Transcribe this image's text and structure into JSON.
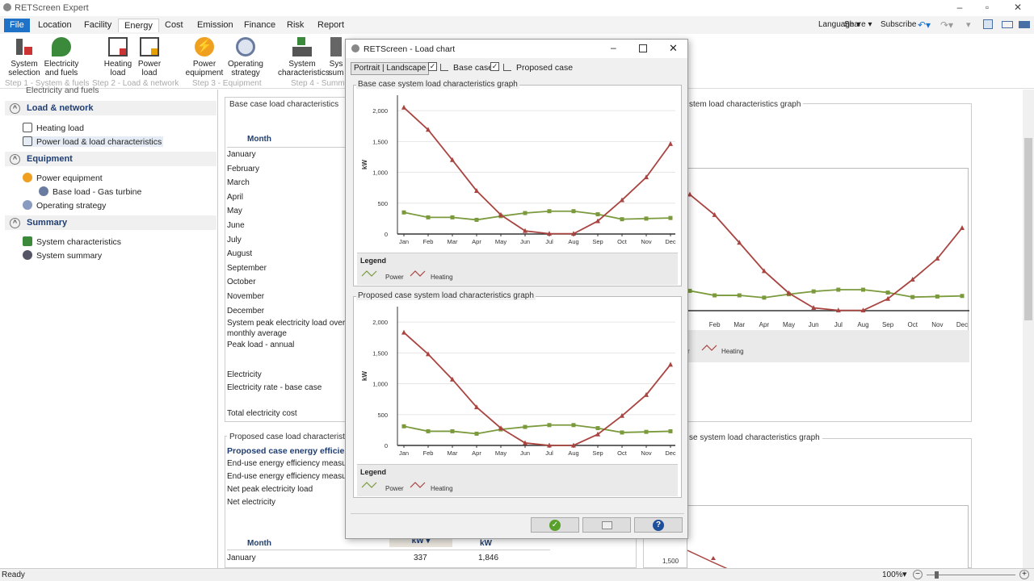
{
  "app": {
    "title": "RETScreen Expert"
  },
  "menu": {
    "items": [
      "File",
      "Location",
      "Facility",
      "Energy",
      "Cost",
      "Emission",
      "Finance",
      "Risk",
      "Report"
    ],
    "right": [
      "Language ▾",
      "Share ▾",
      "Subscribe"
    ]
  },
  "ribbon": {
    "buttons": [
      {
        "l1": "System",
        "l2": "selection"
      },
      {
        "l1": "Electricity",
        "l2": "and fuels"
      },
      {
        "l1": "Heating",
        "l2": "load"
      },
      {
        "l1": "Power",
        "l2": "load"
      },
      {
        "l1": "Power",
        "l2": "equipment"
      },
      {
        "l1": "Operating",
        "l2": "strategy"
      },
      {
        "l1": "System",
        "l2": "characteristics"
      },
      {
        "l1": "Sys",
        "l2": "sum"
      }
    ],
    "steps": [
      "Step 1 - System & fuels",
      "Step 2 - Load & network",
      "Step 3 - Equipment",
      "Step 4 - Summa"
    ]
  },
  "nav": {
    "top_item": "Electricity and fuels",
    "sections": [
      {
        "title": "Load & network",
        "items": [
          "Heating load",
          "Power load & load characteristics"
        ]
      },
      {
        "title": "Equipment",
        "items": [
          "Power equipment",
          "Base load - Gas turbine",
          "Operating strategy"
        ]
      },
      {
        "title": "Summary",
        "items": [
          "System characteristics",
          "System summary"
        ]
      }
    ]
  },
  "main": {
    "base_panel_title": "Base case load characteristics",
    "month_header": "Month",
    "months": [
      "January",
      "February",
      "March",
      "April",
      "May",
      "June",
      "July",
      "August",
      "September",
      "October",
      "November",
      "December"
    ],
    "peak_l1": "System peak electricity load over m",
    "peak_l2": "monthly average",
    "peak_annual": "Peak load - annual",
    "electricity": "Electricity",
    "elec_rate": "Electricity rate - base case",
    "total_cost": "Total electricity cost",
    "right_top_title": "stem load characteristics graph",
    "proposed_panel_title": "Proposed case load characteristics",
    "proposed_bold": "Proposed case energy efficiency",
    "p1": "End-use energy efficiency measure",
    "p2": "End-use energy efficiency measure",
    "p3": "Net peak electricity load",
    "p4": "Net electricity",
    "month2": "Month",
    "unit_dropdown": "kW",
    "unit_kw": "kW",
    "jan_label": "January",
    "jan_v1": "337",
    "jan_v2": "1,846",
    "right_bottom_title": "se system load characteristics graph",
    "bg_legend_heating": "Heating",
    "bg_legend_power_frag": "r",
    "bg_ytick": "1,500"
  },
  "dialog": {
    "title": "RETScreen - Load chart",
    "orientation_btn": "Portrait | Landscape",
    "base_case_label": "Base case",
    "proposed_case_label": "Proposed case",
    "legend_title": "Legend"
  },
  "status": {
    "left": "Ready",
    "zoom": "100%"
  },
  "colors": {
    "power": "#7a9a3c",
    "heating": "#a94440",
    "accent": "#1e73c8"
  },
  "chart_data": [
    {
      "type": "line",
      "title": "Base case system load characteristics graph",
      "ylabel": "kW",
      "categories": [
        "Jan",
        "Feb",
        "Mar",
        "Apr",
        "May",
        "Jun",
        "Jul",
        "Aug",
        "Sep",
        "Oct",
        "Nov",
        "Dec"
      ],
      "ylim": [
        0,
        2250
      ],
      "yticks": [
        "0",
        "500",
        "1,000",
        "1,500",
        "2,000"
      ],
      "series": [
        {
          "name": "Power",
          "values": [
            350,
            270,
            270,
            230,
            290,
            340,
            370,
            370,
            320,
            240,
            250,
            260
          ]
        },
        {
          "name": "Heating",
          "values": [
            2050,
            1690,
            1200,
            700,
            310,
            50,
            5,
            5,
            210,
            550,
            920,
            1460
          ]
        }
      ],
      "legend": "bottom"
    },
    {
      "type": "line",
      "title": "Proposed case system load characteristics graph",
      "ylabel": "kW",
      "categories": [
        "Jan",
        "Feb",
        "Mar",
        "Apr",
        "May",
        "Jun",
        "Jul",
        "Aug",
        "Sep",
        "Oct",
        "Nov",
        "Dec"
      ],
      "ylim": [
        0,
        2250
      ],
      "yticks": [
        "0",
        "500",
        "1,000",
        "1,500",
        "2,000"
      ],
      "series": [
        {
          "name": "Power",
          "values": [
            310,
            230,
            230,
            190,
            260,
            300,
            330,
            330,
            280,
            210,
            220,
            230
          ]
        },
        {
          "name": "Heating",
          "values": [
            1830,
            1480,
            1070,
            620,
            280,
            40,
            0,
            0,
            180,
            480,
            820,
            1310
          ]
        }
      ],
      "legend": "bottom"
    }
  ]
}
